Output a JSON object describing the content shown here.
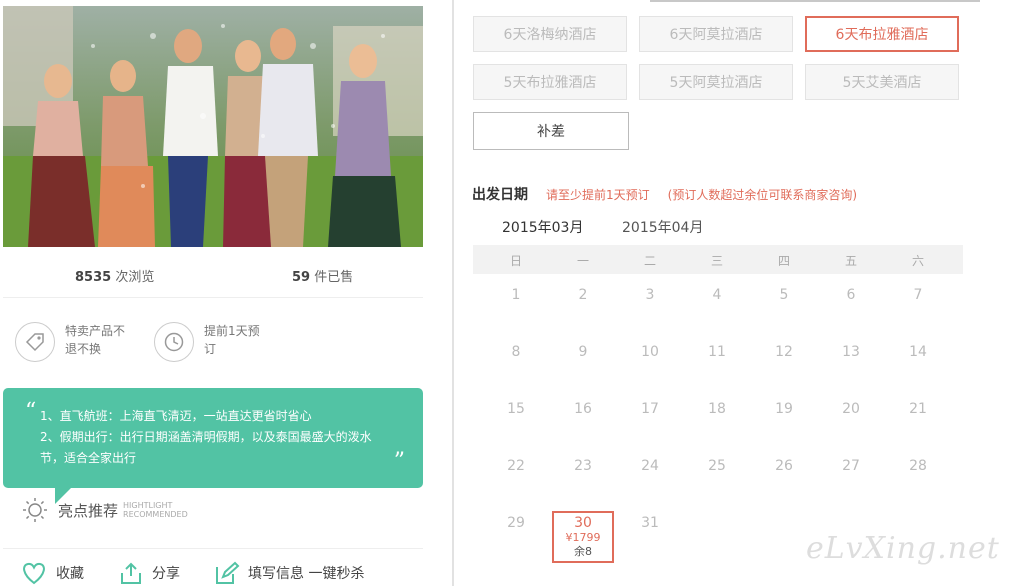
{
  "stats": {
    "views_count": "8535",
    "views_label": "次浏览",
    "sold_count": "59",
    "sold_label": "件已售"
  },
  "badges": [
    {
      "icon": "tag-icon",
      "text": "特卖产品不退不换"
    },
    {
      "icon": "clock-history-icon",
      "text": "提前1天预订"
    }
  ],
  "quote": {
    "line1": "1、直飞航班：上海直飞清迈，一站直达更省时省心",
    "line2": "2、假期出行：出行日期涵盖清明假期，以及泰国最盛大的泼水节，适合全家出行",
    "open_mark": "“",
    "close_mark": "”"
  },
  "highlight": {
    "title": "亮点推荐",
    "en_line1": "HIGHTLIGHT",
    "en_line2": "RECOMMENDED"
  },
  "actions": [
    {
      "icon": "heart-icon",
      "label": "收藏"
    },
    {
      "icon": "share-icon",
      "label": "分享"
    },
    {
      "icon": "edit-icon",
      "label": "填写信息 一键秒杀"
    }
  ],
  "hotel_options": [
    {
      "label": "6天洛梅纳酒店",
      "selected": false
    },
    {
      "label": "6天阿莫拉酒店",
      "selected": false
    },
    {
      "label": "6天布拉雅酒店",
      "selected": true
    },
    {
      "label": "5天布拉雅酒店",
      "selected": false
    },
    {
      "label": "5天阿莫拉酒店",
      "selected": false
    },
    {
      "label": "5天艾美酒店",
      "selected": false
    }
  ],
  "supplement_label": "补差",
  "departure": {
    "title": "出发日期",
    "note1": "请至少提前1天预订",
    "note2": "(预订人数超过余位可联系商家咨询)"
  },
  "months": [
    {
      "label": "2015年03月",
      "active": true
    },
    {
      "label": "2015年04月",
      "active": false
    }
  ],
  "weekdays": [
    "日",
    "一",
    "二",
    "三",
    "四",
    "五",
    "六"
  ],
  "days": [
    [
      "1",
      "2",
      "3",
      "4",
      "5",
      "6",
      "7"
    ],
    [
      "8",
      "9",
      "10",
      "11",
      "12",
      "13",
      "14"
    ],
    [
      "15",
      "16",
      "17",
      "18",
      "19",
      "20",
      "21"
    ],
    [
      "22",
      "23",
      "24",
      "25",
      "26",
      "27",
      "28"
    ],
    [
      "29",
      "30",
      "31"
    ]
  ],
  "selected_day": {
    "day": "30",
    "price": "¥1799",
    "remaining": "余8"
  },
  "watermark": "eLvXing.net",
  "colors": {
    "accent": "#e06c5a",
    "quote_bg": "#52c3a4"
  }
}
